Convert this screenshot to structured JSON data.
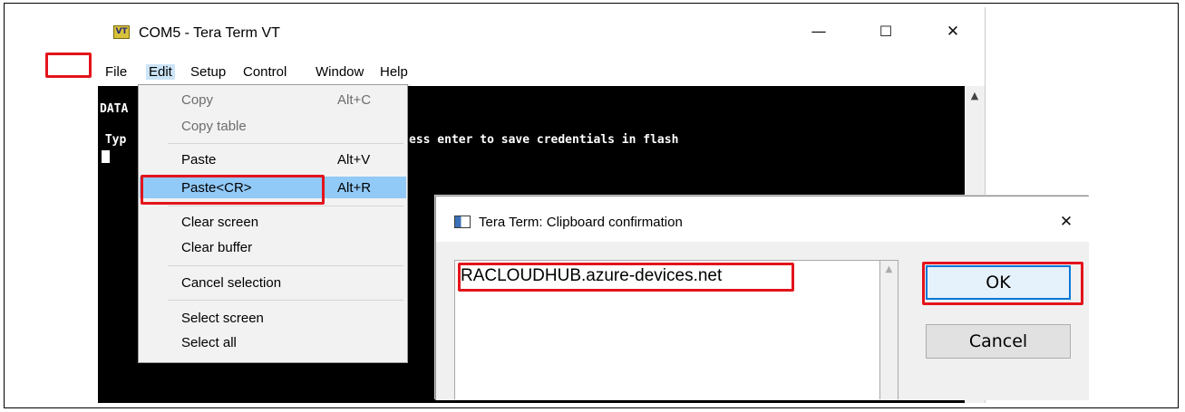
{
  "window": {
    "icon_label": "VT",
    "title": "COM5 - Tera Term VT",
    "minimize": "—",
    "maximize": "☐",
    "close": "✕"
  },
  "menubar": {
    "items": [
      "File",
      "Edit",
      "Setup",
      "Control",
      "Window",
      "Help"
    ]
  },
  "terminal": {
    "line1": "DATA",
    "line2_left": " Typ",
    "line2_right": "ess enter to save credentials in flash",
    "scroll_up": "▲"
  },
  "edit_menu": {
    "items": [
      {
        "label": "Copy",
        "shortcut": "Alt+C",
        "disabled": true
      },
      {
        "label": "Copy table",
        "shortcut": "",
        "disabled": true
      },
      {
        "label": "Paste",
        "shortcut": "Alt+V",
        "disabled": false
      },
      {
        "label": "Paste<CR>",
        "shortcut": "Alt+R",
        "disabled": false,
        "highlighted": true
      },
      {
        "label": "Clear screen",
        "shortcut": "",
        "disabled": false
      },
      {
        "label": "Clear buffer",
        "shortcut": "",
        "disabled": false
      },
      {
        "label": "Cancel selection",
        "shortcut": "",
        "disabled": false
      },
      {
        "label": "Select screen",
        "shortcut": "",
        "disabled": false
      },
      {
        "label": "Select all",
        "shortcut": "",
        "disabled": false
      }
    ]
  },
  "dialog": {
    "title": "Tera Term: Clipboard confirmation",
    "close": "✕",
    "text_value": "RACLOUDHUB.azure-devices.net",
    "scroll_up": "▲",
    "ok_label": "OK",
    "cancel_label": "Cancel"
  },
  "colors": {
    "highlight_box": "#e3141c",
    "menu_highlight": "#91c9f7",
    "terminal_bg": "#000000",
    "ok_border": "#0078d7"
  }
}
